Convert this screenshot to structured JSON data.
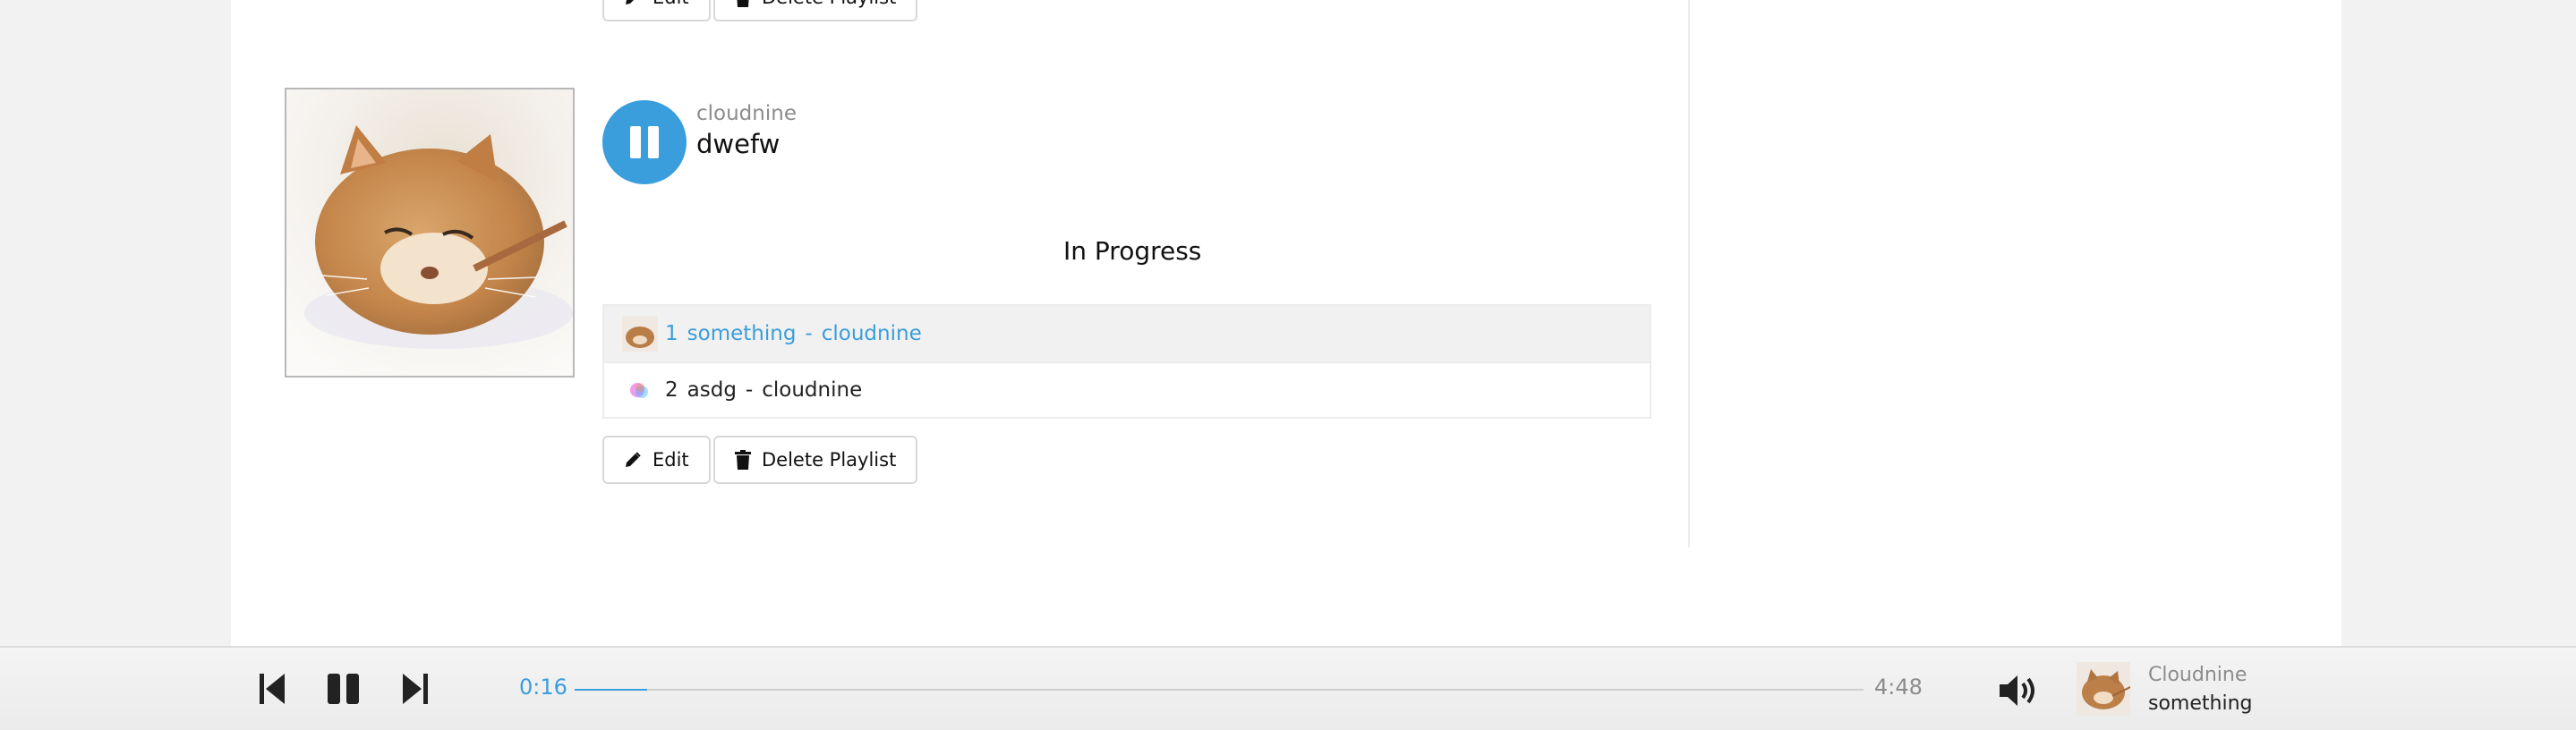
{
  "previous_playlist": {
    "edit_label": "Edit",
    "delete_label": "Delete Playlist"
  },
  "playlist": {
    "owner": "cloudnine",
    "title": "dwefw",
    "status": "In Progress",
    "playing": true,
    "tracks": [
      {
        "number": "1",
        "title": "something",
        "separator": "-",
        "artist": "cloudnine",
        "active": true
      },
      {
        "number": "2",
        "title": "asdg",
        "separator": "-",
        "artist": "cloudnine",
        "active": false
      }
    ],
    "edit_label": "Edit",
    "delete_label": "Delete Playlist"
  },
  "player": {
    "elapsed": "0:16",
    "duration": "4:48",
    "progress_fraction": 0.056,
    "now_playing": {
      "artist": "Cloudnine",
      "title": "something"
    },
    "icons": [
      "skip-back-icon",
      "pause-icon",
      "skip-forward-icon",
      "volume-icon"
    ]
  },
  "colors": {
    "accent": "#3a9ddc",
    "page_bg": "#f2f2f2",
    "panel_bg": "#ffffff",
    "muted_text": "#8c8c8c",
    "active_row_bg": "#f1f1f1"
  }
}
